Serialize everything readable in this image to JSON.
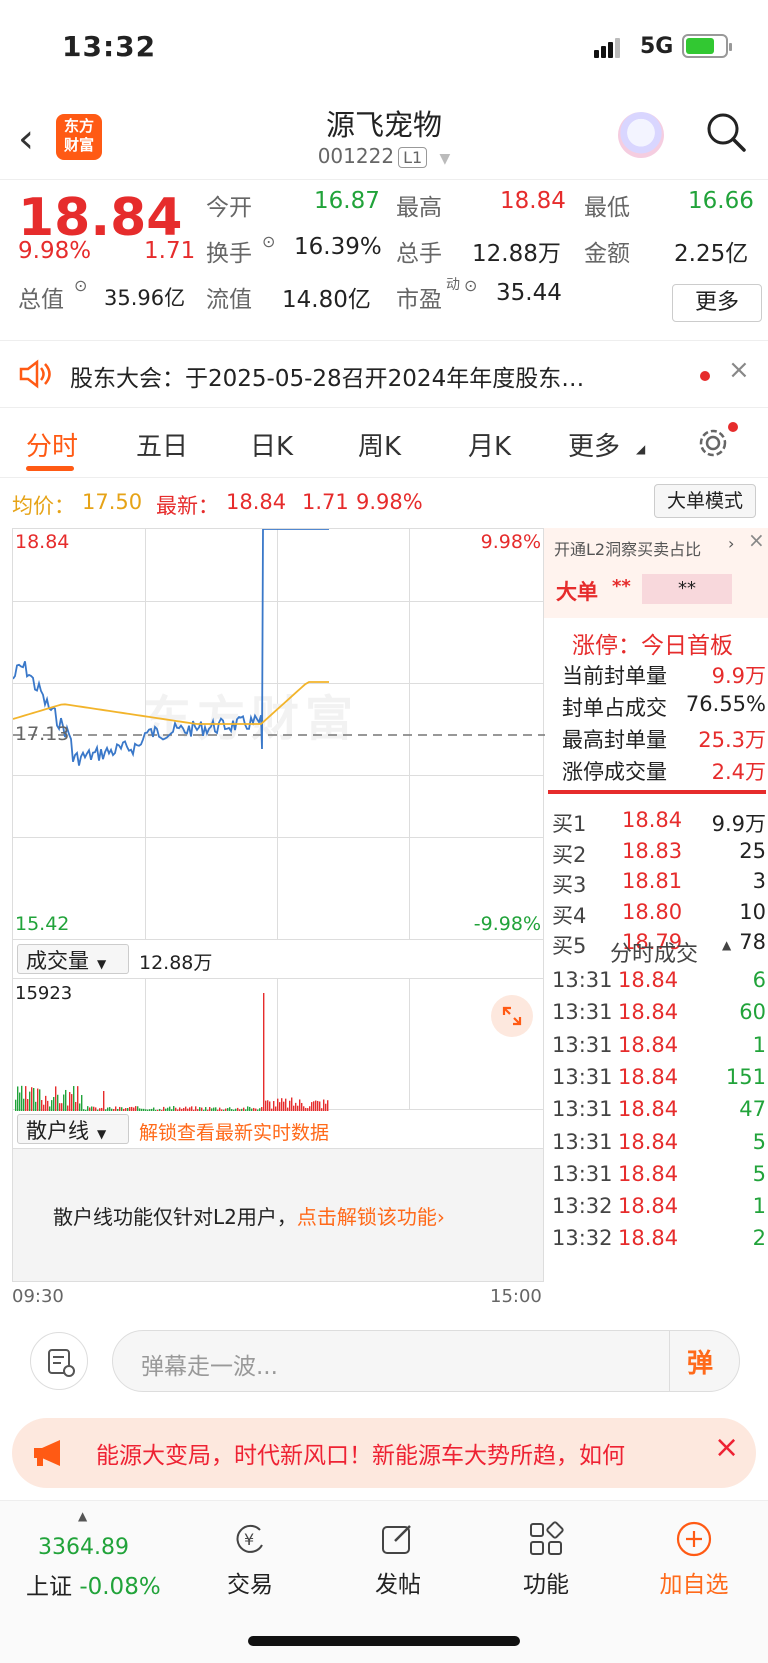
{
  "status": {
    "time": "13:32",
    "network": "5G"
  },
  "nav": {
    "back_icon": "chevron-left-icon",
    "logo_line1": "东方",
    "logo_line2": "财富",
    "title": "源飞宠物",
    "code": "001222",
    "level": "L1"
  },
  "quote": {
    "price": "18.84",
    "pct": "9.98%",
    "chg": "1.71",
    "open_label": "今开",
    "open": "16.87",
    "high_label": "最高",
    "high": "18.84",
    "low_label": "最低",
    "low": "16.66",
    "turnover_label": "换手",
    "turnover": "16.39%",
    "volume_label": "总手",
    "volume": "12.88万",
    "amount_label": "金额",
    "amount": "2.25亿",
    "mktcap_label": "总值",
    "mktcap": "35.96亿",
    "float_label": "流值",
    "float": "14.80亿",
    "pe_label": "市盈",
    "pe_sup": "动",
    "pe": "35.44",
    "more": "更多"
  },
  "notice": {
    "text": "股东大会：于2025-05-28召开2024年年度股东…"
  },
  "tabs": [
    "分时",
    "五日",
    "日K",
    "周K",
    "月K",
    "更多"
  ],
  "info": {
    "avg_label": "均价：",
    "avg": "17.50",
    "latest_label": "最新：",
    "latest": "18.84",
    "chg": "1.71",
    "pct": "9.98%",
    "mode_btn": "大单模式"
  },
  "chart": {
    "y_top": "18.84",
    "y_mid": "17.13",
    "y_bottom": "15.42",
    "pct_top": "9.98%",
    "pct_bottom": "-9.98%",
    "watermark": "东方财富",
    "vol_label": "成交量",
    "vol_total": "12.88万",
    "vol_max": "15923",
    "retail_label": "散户线",
    "retail_unlock": "解锁查看最新实时数据",
    "retail_msg": "散户线功能仅针对L2用户，",
    "retail_link": "点击解锁该功能",
    "t_start": "09:30",
    "t_end": "15:00"
  },
  "chart_data": {
    "type": "line",
    "series": [
      {
        "name": "",
        "role": "price",
        "color": "#3a78c9"
      },
      {
        "name": "",
        "role": "average",
        "color": "#f2b42b"
      }
    ],
    "ylim": [
      15.42,
      18.84
    ],
    "baseline": 17.13
  },
  "side": {
    "promo": "开通L2洞察买卖占比",
    "big_label": "大单",
    "big_v1": "**",
    "big_v2": "**",
    "limit_title": "涨停：今日首板",
    "rows": [
      {
        "label": "当前封单量",
        "value": "9.9万"
      },
      {
        "label": "封单占成交",
        "value": "76.55%"
      },
      {
        "label": "最高封单量",
        "value": "25.3万"
      },
      {
        "label": "涨停成交量",
        "value": "2.4万"
      }
    ],
    "bids": [
      {
        "label": "买1",
        "price": "18.84",
        "vol": "9.9万"
      },
      {
        "label": "买2",
        "price": "18.83",
        "vol": "25"
      },
      {
        "label": "买3",
        "price": "18.81",
        "vol": "3"
      },
      {
        "label": "买4",
        "price": "18.80",
        "vol": "10"
      },
      {
        "label": "买5",
        "price": "18.79",
        "vol": "78"
      }
    ],
    "ticks_title": "分时成交",
    "ticks": [
      {
        "t": "13:31",
        "p": "18.84",
        "v": "6"
      },
      {
        "t": "13:31",
        "p": "18.84",
        "v": "60"
      },
      {
        "t": "13:31",
        "p": "18.84",
        "v": "1"
      },
      {
        "t": "13:31",
        "p": "18.84",
        "v": "151"
      },
      {
        "t": "13:31",
        "p": "18.84",
        "v": "47"
      },
      {
        "t": "13:31",
        "p": "18.84",
        "v": "5"
      },
      {
        "t": "13:31",
        "p": "18.84",
        "v": "5"
      },
      {
        "t": "13:32",
        "p": "18.84",
        "v": "1"
      },
      {
        "t": "13:32",
        "p": "18.84",
        "v": "2"
      }
    ]
  },
  "danmu": {
    "placeholder": "弹幕走一波...",
    "send": "弹"
  },
  "ad": {
    "text": "能源大变局，时代新风口！新能源车大势所趋，如何"
  },
  "bottom": {
    "index_value": "3364.89",
    "index_name": "上证",
    "index_pct": "-0.08%",
    "trade": "交易",
    "post": "发帖",
    "func": "功能",
    "add": "加自选"
  }
}
